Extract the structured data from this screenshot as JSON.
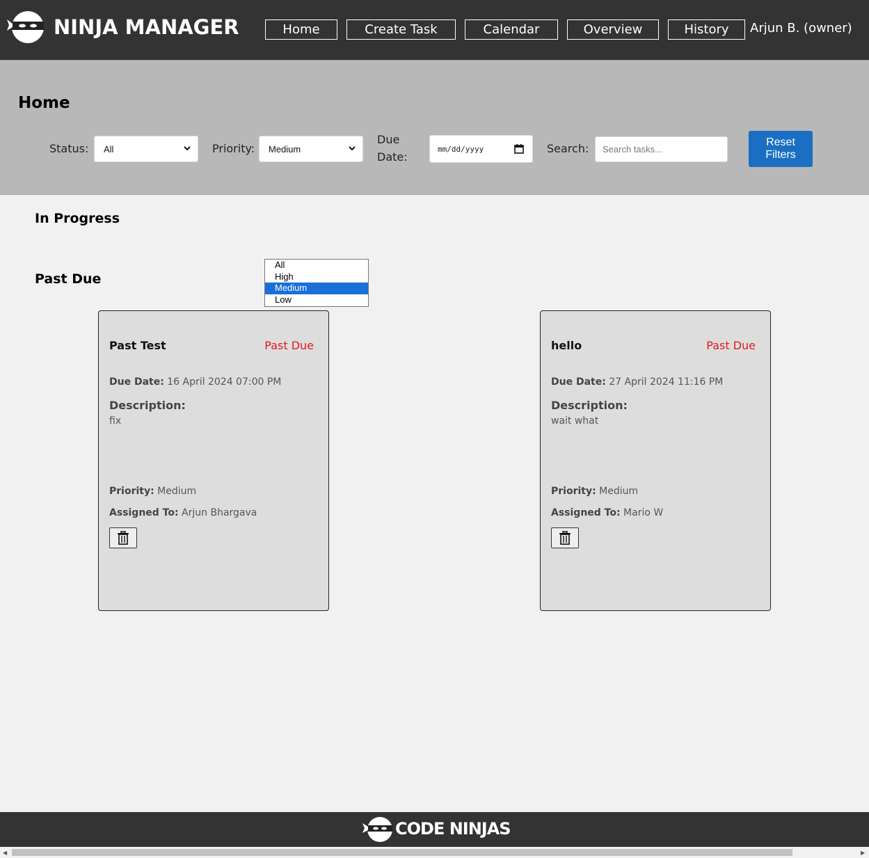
{
  "header": {
    "brand": "NINJA MANAGER",
    "nav": [
      "Home",
      "Create Task",
      "Calendar",
      "Overview",
      "History"
    ],
    "user": "Arjun B. (owner)"
  },
  "filters": {
    "title": "Home",
    "status_label": "Status:",
    "status_value": "All",
    "priority_label": "Priority:",
    "priority_value": "Medium",
    "due_label_1": "Due",
    "due_label_2": "Date:",
    "date_placeholder": "mm/dd/yyyy",
    "search_label": "Search:",
    "search_placeholder": "Search tasks...",
    "reset_line1": "Reset",
    "reset_line2": "Filters"
  },
  "priority_options": [
    "All",
    "High",
    "Medium",
    "Low"
  ],
  "sections": {
    "in_progress": "In Progress",
    "past_due": "Past Due"
  },
  "cards": [
    {
      "title": "Past Test",
      "status": "Past Due",
      "due_label": "Due Date:",
      "due": "16 April 2024 07:00 PM",
      "desc_label": "Description:",
      "desc": "fix",
      "priority_label": "Priority:",
      "priority": "Medium",
      "assigned_label": "Assigned To:",
      "assigned": "Arjun Bhargava"
    },
    {
      "title": "hello",
      "status": "Past Due",
      "due_label": "Due Date:",
      "due": "27 April 2024 11:16 PM",
      "desc_label": "Description:",
      "desc": "wait what",
      "priority_label": "Priority:",
      "priority": "Medium",
      "assigned_label": "Assigned To:",
      "assigned": "Mario W"
    }
  ],
  "footer": {
    "brand": "CODE NINJAS"
  },
  "colors": {
    "topbar": "#333333",
    "filters_bg": "#b8b8b8",
    "accent": "#1a6fc2",
    "past_due": "#e41a1a"
  }
}
